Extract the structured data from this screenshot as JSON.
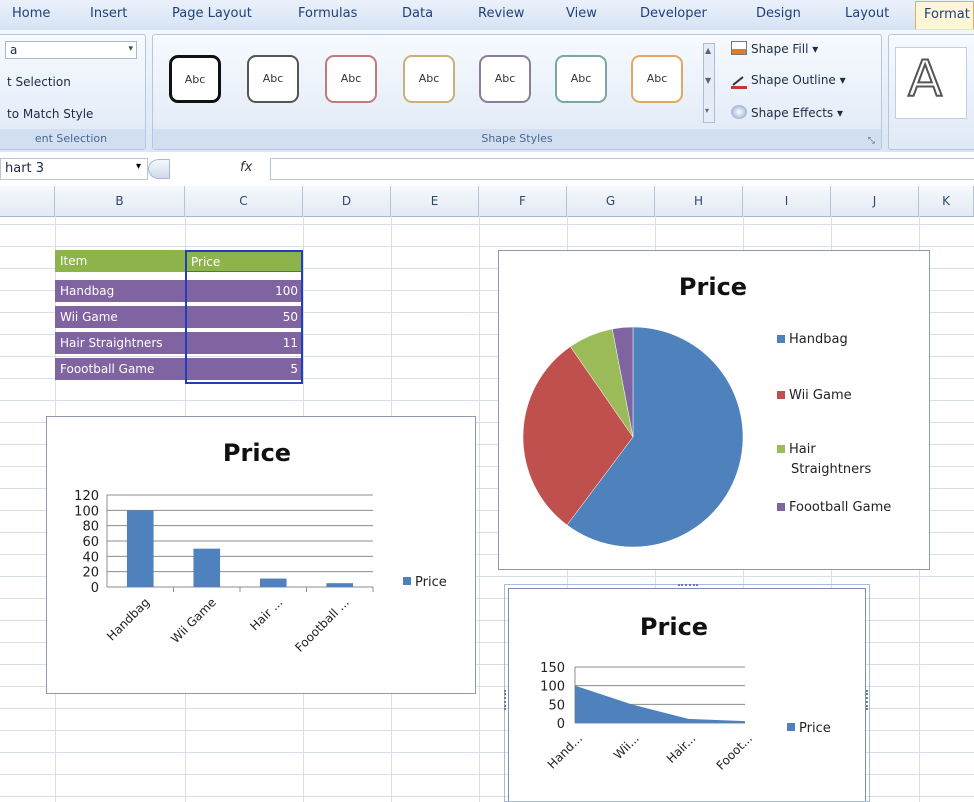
{
  "ribbon": {
    "tabs": [
      "Home",
      "Insert",
      "Page Layout",
      "Formulas",
      "Data",
      "Review",
      "View",
      "Developer",
      "Design",
      "Layout",
      "Format"
    ],
    "active_tab": "Format",
    "current_selection": {
      "dropdown_value": "a",
      "format_selection": "t Selection",
      "reset_to_match": "to Match Style",
      "group_label": "ent Selection"
    },
    "shape_styles": {
      "preview_label": "Abc",
      "group_label": "Shape Styles",
      "fill": "Shape Fill",
      "outline": "Shape Outline",
      "effects": "Shape Effects"
    },
    "wordart_letter": "A"
  },
  "formula_bar": {
    "name_box": "hart 3",
    "fx": "fx",
    "formula": ""
  },
  "columns": [
    "B",
    "C",
    "D",
    "E",
    "F",
    "G",
    "H",
    "I",
    "J",
    "K"
  ],
  "table": {
    "headers": [
      "Item",
      "Price"
    ],
    "rows": [
      [
        "Handbag",
        "100"
      ],
      [
        "Wii Game",
        "50"
      ],
      [
        "Hair Straightners",
        "11"
      ],
      [
        "Foootball Game",
        "5"
      ]
    ]
  },
  "chart_data": [
    {
      "type": "bar",
      "title": "Price",
      "categories": [
        "Handbag",
        "Wii Game",
        "Hair ...",
        "Foootball ..."
      ],
      "series": [
        {
          "name": "Price",
          "values": [
            100,
            50,
            11,
            5
          ]
        }
      ],
      "ylim": [
        0,
        120
      ],
      "yticks": [
        0,
        20,
        40,
        60,
        80,
        100,
        120
      ],
      "legend": "right",
      "grid": true
    },
    {
      "type": "pie",
      "title": "Price",
      "categories": [
        "Handbag",
        "Wii Game",
        "Hair Straightners",
        "Foootball Game"
      ],
      "values": [
        100,
        50,
        11,
        5
      ],
      "legend": "right",
      "colors": [
        "#4f81bd",
        "#c0504d",
        "#9bbb59",
        "#8064a2"
      ]
    },
    {
      "type": "area",
      "title": "Price",
      "categories": [
        "Hand...",
        "Wii...",
        "Hair...",
        "Fooot..."
      ],
      "series": [
        {
          "name": "Price",
          "values": [
            100,
            50,
            11,
            5
          ]
        }
      ],
      "ylim": [
        0,
        150
      ],
      "yticks": [
        0,
        50,
        100,
        150
      ],
      "legend": "right",
      "grid": true
    }
  ],
  "colors": {
    "series_blue": "#4f81bd",
    "red": "#c0504d",
    "green": "#9bbb59",
    "purple": "#8064a2",
    "header_green": "#8db34a",
    "row_purple": "#8064a2"
  }
}
